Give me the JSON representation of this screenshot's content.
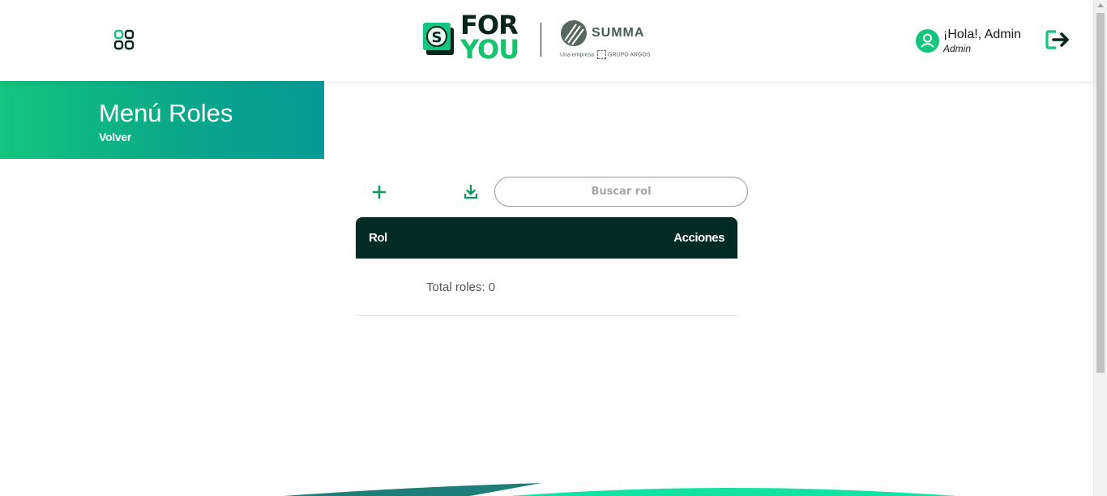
{
  "header": {
    "apps_icon": "apps-grid-icon",
    "brand": {
      "line1": "FOR",
      "line2": "YOU",
      "badge_letter": "S",
      "divider": true
    },
    "partner": {
      "name": "SUMMA",
      "sub_prefix": "Una empresa",
      "sub_group": "GRUPO ARGOS"
    },
    "user": {
      "greeting": "¡Hola!, Admin",
      "role": "Admin",
      "avatar_icon": "user-icon"
    },
    "logout_icon": "logout-icon"
  },
  "banner": {
    "title": "Menú Roles",
    "back_label": "Volver"
  },
  "toolbar": {
    "add_icon": "plus-icon",
    "download_icon": "download-icon",
    "search_placeholder": "Buscar rol",
    "search_value": ""
  },
  "table": {
    "columns": [
      "Rol",
      "Acciones"
    ],
    "rows": [],
    "total_label": "Total roles: 0"
  },
  "colors": {
    "accent": "#14c47f",
    "table_header": "#022c23",
    "banner_start": "#14c47f",
    "banner_end": "#049a96"
  }
}
